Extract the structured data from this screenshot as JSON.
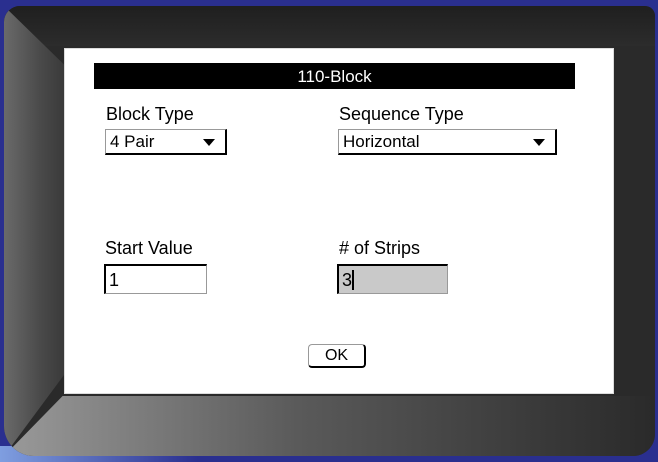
{
  "dialog": {
    "title": "110-Block",
    "block_type": {
      "label": "Block Type",
      "value": "4 Pair"
    },
    "sequence_type": {
      "label": "Sequence Type",
      "value": "Horizontal"
    },
    "start_value": {
      "label": "Start Value",
      "value": "1"
    },
    "num_strips": {
      "label": "# of Strips",
      "value": "3"
    },
    "ok_label": "OK"
  }
}
